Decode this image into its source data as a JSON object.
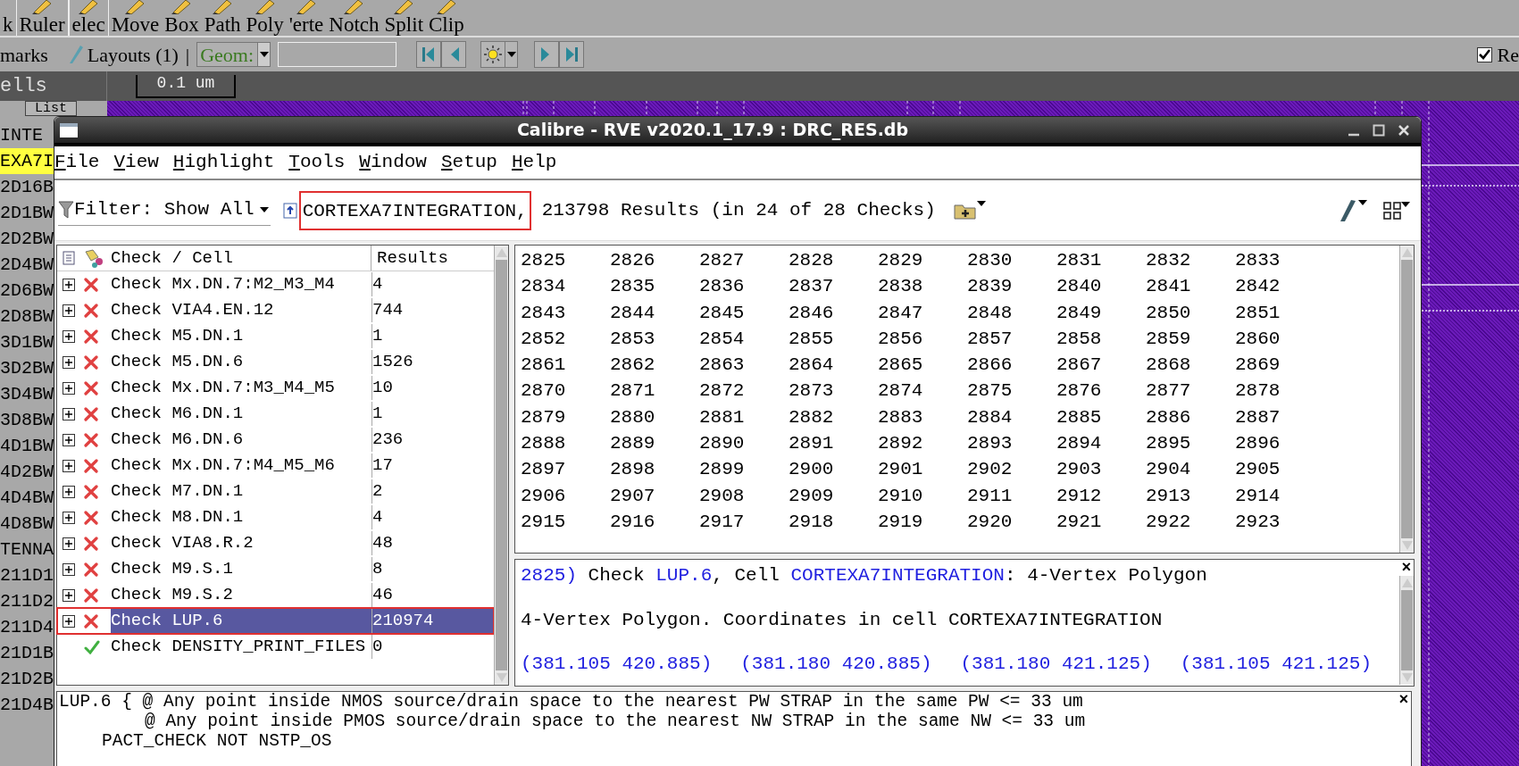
{
  "main_toolbar": {
    "tools": [
      "k",
      "Ruler",
      "elec",
      "Move",
      "Box",
      "Path",
      "Poly",
      "'erte",
      "Notch",
      "Split",
      "Clip"
    ]
  },
  "secondary_toolbar": {
    "bookmarks": "marks",
    "layouts": "Layouts (1)",
    "separator": "|",
    "geom": "Geom:",
    "checkbox": {
      "label": "Re",
      "checked": true
    }
  },
  "cells_panel": {
    "title": "ells",
    "tab": "List",
    "items": [
      {
        "name": "INTE",
        "selected": false
      },
      {
        "name": "EXA7I",
        "selected": true
      },
      {
        "name": "2D16B",
        "selected": false
      },
      {
        "name": "2D1BW",
        "selected": false
      },
      {
        "name": "2D2BW",
        "selected": false
      },
      {
        "name": "2D4BW",
        "selected": false
      },
      {
        "name": "2D6BW",
        "selected": false
      },
      {
        "name": "2D8BW",
        "selected": false
      },
      {
        "name": "3D1BW",
        "selected": false
      },
      {
        "name": "3D2BW",
        "selected": false
      },
      {
        "name": "3D4BW",
        "selected": false
      },
      {
        "name": "3D8BW",
        "selected": false
      },
      {
        "name": "4D1BW",
        "selected": false
      },
      {
        "name": "4D2BW",
        "selected": false
      },
      {
        "name": "4D4BW",
        "selected": false
      },
      {
        "name": "4D8BW",
        "selected": false
      },
      {
        "name": "TENNA",
        "selected": false
      },
      {
        "name": "211D1",
        "selected": false
      },
      {
        "name": "211D2",
        "selected": false
      },
      {
        "name": "211D4",
        "selected": false
      },
      {
        "name": "21D1B",
        "selected": false
      },
      {
        "name": "21D2B",
        "selected": false
      },
      {
        "name": "21D4B",
        "selected": false
      }
    ]
  },
  "scale_bar": "0.1 um",
  "window": {
    "title": "Calibre - RVE v2020.1_17.9 : DRC_RES.db",
    "menu": [
      "File",
      "View",
      "Highlight",
      "Tools",
      "Window",
      "Setup",
      "Help"
    ],
    "toolbar": {
      "filter": "Filter: Show All",
      "cell": "CORTEXA7INTEGRATION,",
      "cell_marked": true,
      "summary": "213798 Results (in 24 of 28 Checks)"
    },
    "tree": {
      "columns": [
        "Check / Cell",
        "Results"
      ],
      "rows": [
        {
          "kind": "fail",
          "name": "Check Mx.DN.7:M2_M3_M4",
          "results": "4",
          "selected": false
        },
        {
          "kind": "fail",
          "name": "Check VIA4.EN.12",
          "results": "744",
          "selected": false
        },
        {
          "kind": "fail",
          "name": "Check M5.DN.1",
          "results": "1",
          "selected": false
        },
        {
          "kind": "fail",
          "name": "Check M5.DN.6",
          "results": "1526",
          "selected": false
        },
        {
          "kind": "fail",
          "name": "Check Mx.DN.7:M3_M4_M5",
          "results": "10",
          "selected": false
        },
        {
          "kind": "fail",
          "name": "Check M6.DN.1",
          "results": "1",
          "selected": false
        },
        {
          "kind": "fail",
          "name": "Check M6.DN.6",
          "results": "236",
          "selected": false
        },
        {
          "kind": "fail",
          "name": "Check Mx.DN.7:M4_M5_M6",
          "results": "17",
          "selected": false
        },
        {
          "kind": "fail",
          "name": "Check M7.DN.1",
          "results": "2",
          "selected": false
        },
        {
          "kind": "fail",
          "name": "Check M8.DN.1",
          "results": "4",
          "selected": false
        },
        {
          "kind": "fail",
          "name": "Check VIA8.R.2",
          "results": "48",
          "selected": false
        },
        {
          "kind": "fail",
          "name": "Check M9.S.1",
          "results": "8",
          "selected": false
        },
        {
          "kind": "fail",
          "name": "Check M9.S.2",
          "results": "46",
          "selected": false
        },
        {
          "kind": "fail",
          "name": "Check LUP.6",
          "results": "210974",
          "selected": true
        },
        {
          "kind": "pass",
          "name": "Check DENSITY_PRINT_FILES",
          "results": "0",
          "selected": false
        }
      ]
    },
    "result_grid": [
      [
        "2825",
        "2826",
        "2827",
        "2828",
        "2829",
        "2830",
        "2831",
        "2832",
        "2833"
      ],
      [
        "2834",
        "2835",
        "2836",
        "2837",
        "2838",
        "2839",
        "2840",
        "2841",
        "2842"
      ],
      [
        "2843",
        "2844",
        "2845",
        "2846",
        "2847",
        "2848",
        "2849",
        "2850",
        "2851"
      ],
      [
        "2852",
        "2853",
        "2854",
        "2855",
        "2856",
        "2857",
        "2858",
        "2859",
        "2860"
      ],
      [
        "2861",
        "2862",
        "2863",
        "2864",
        "2865",
        "2866",
        "2867",
        "2868",
        "2869"
      ],
      [
        "2870",
        "2871",
        "2872",
        "2873",
        "2874",
        "2875",
        "2876",
        "2877",
        "2878"
      ],
      [
        "2879",
        "2880",
        "2881",
        "2882",
        "2883",
        "2884",
        "2885",
        "2886",
        "2887"
      ],
      [
        "2888",
        "2889",
        "2890",
        "2891",
        "2892",
        "2893",
        "2894",
        "2895",
        "2896"
      ],
      [
        "2897",
        "2898",
        "2899",
        "2900",
        "2901",
        "2902",
        "2903",
        "2904",
        "2905"
      ],
      [
        "2906",
        "2907",
        "2908",
        "2909",
        "2910",
        "2911",
        "2912",
        "2913",
        "2914"
      ],
      [
        "2915",
        "2916",
        "2917",
        "2918",
        "2919",
        "2920",
        "2921",
        "2922",
        "2923"
      ]
    ],
    "detail": {
      "close": "×",
      "heading": [
        {
          "text": "2825)",
          "link": true
        },
        {
          "text": " Check ",
          "link": false
        },
        {
          "text": "LUP.6",
          "link": true
        },
        {
          "text": ", Cell ",
          "link": false
        },
        {
          "text": "CORTEXA7INTEGRATION",
          "link": true
        },
        {
          "text": ": 4-Vertex Polygon",
          "link": false
        }
      ],
      "description": "4-Vertex Polygon. Coordinates in cell CORTEXA7INTEGRATION",
      "coordinates": [
        "(381.105 420.885)",
        "(381.180 420.885)",
        "(381.180 421.125)",
        "(381.105 421.125)"
      ]
    },
    "rule_text": {
      "close": "×",
      "lines": [
        {
          "kind": "head",
          "text": "LUP.6 { @ Any point inside NMOS source/drain space to the nearest PW STRAP in the same PW <= 33 um"
        },
        {
          "kind": "comment",
          "text": "@ Any point inside PMOS source/drain space to the nearest NW STRAP in the same NW <= 33 um"
        },
        {
          "kind": "body",
          "text": "PACT_CHECK NOT NSTP_OS"
        }
      ]
    }
  }
}
